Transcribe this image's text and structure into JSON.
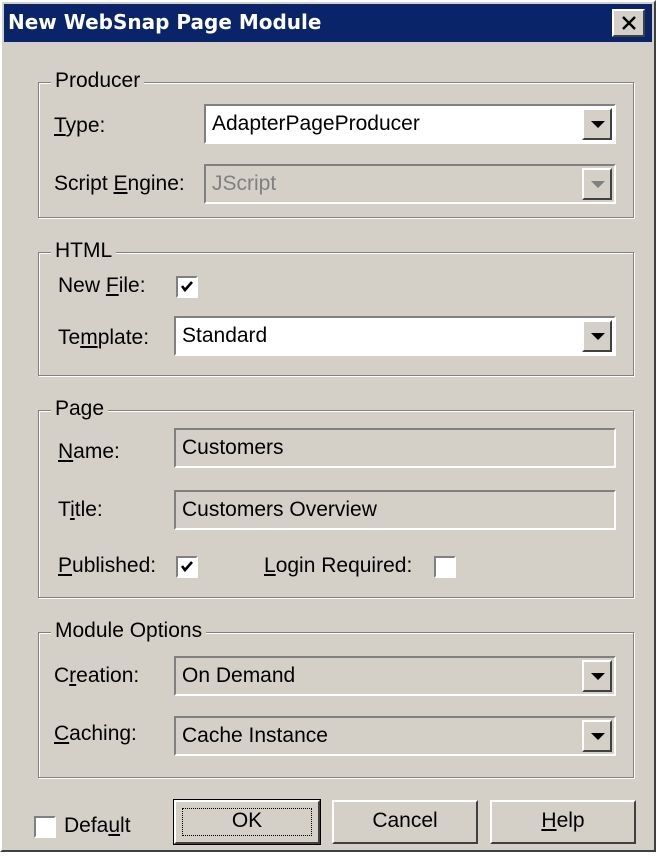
{
  "window": {
    "title": "New WebSnap Page Module"
  },
  "producer": {
    "legend": "Producer",
    "type_label_pre": "",
    "type_label_key": "T",
    "type_label_post": "ype:",
    "type_value": "AdapterPageProducer",
    "engine_label_pre": "Script ",
    "engine_label_key": "E",
    "engine_label_post": "ngine:",
    "engine_value": "JScript"
  },
  "html": {
    "legend": "HTML",
    "newfile_label_pre": "New ",
    "newfile_label_key": "F",
    "newfile_label_post": "ile:",
    "newfile_checked": true,
    "template_label_pre": "Te",
    "template_label_key": "m",
    "template_label_post": "plate:",
    "template_value": "Standard"
  },
  "page": {
    "legend": "Page",
    "name_label_pre": "",
    "name_label_key": "N",
    "name_label_post": "ame:",
    "name_value": "Customers",
    "title_label_pre": "T",
    "title_label_key": "i",
    "title_label_post": "tle:",
    "title_value": "Customers Overview",
    "published_label_pre": "",
    "published_label_key": "P",
    "published_label_post": "ublished:",
    "published_checked": true,
    "login_label_pre": "",
    "login_label_key": "L",
    "login_label_post": "ogin Required:",
    "login_checked": false
  },
  "module": {
    "legend": "Module Options",
    "creation_label_pre": "C",
    "creation_label_key": "r",
    "creation_label_post": "eation:",
    "creation_value": "On Demand",
    "caching_label_pre": "",
    "caching_label_key": "C",
    "caching_label_post": "aching:",
    "caching_value": "Cache Instance"
  },
  "footer": {
    "default_label_pre": "Defa",
    "default_label_key": "u",
    "default_label_post": "lt",
    "default_checked": false,
    "ok_label": "OK",
    "cancel_label": "Cancel",
    "help_label_key": "H",
    "help_label_post": "elp"
  }
}
